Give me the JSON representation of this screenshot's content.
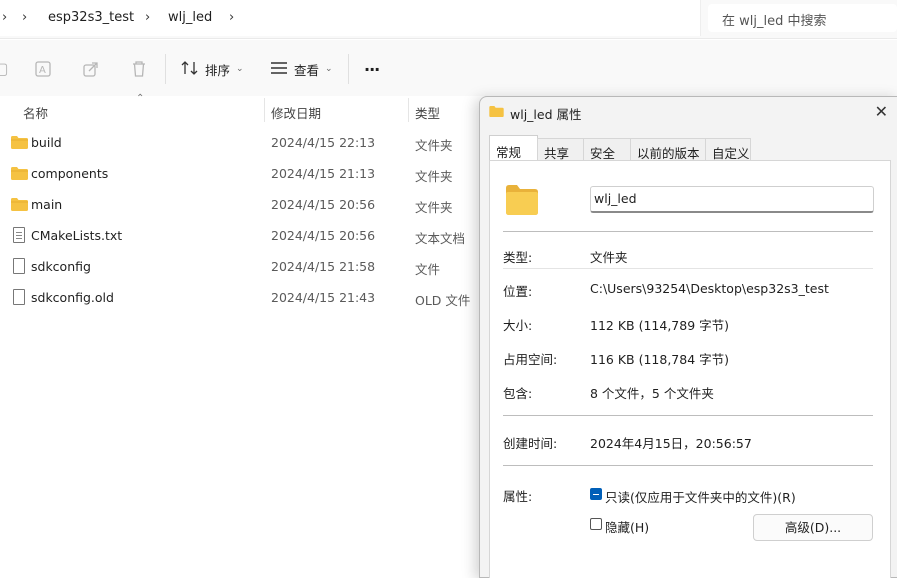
{
  "address": {
    "crumbs": [
      "esp32s3_test",
      "wlj_led"
    ],
    "search_placeholder": "在 wlj_led 中搜索"
  },
  "toolbar": {
    "sort_label": "排序",
    "view_label": "查看",
    "more_label": "···"
  },
  "columns": {
    "name": "名称",
    "date": "修改日期",
    "type": "类型"
  },
  "files": [
    {
      "name": "build",
      "date": "2024/4/15 22:13",
      "type": "文件夹",
      "icon": "folder-icon"
    },
    {
      "name": "components",
      "date": "2024/4/15 21:13",
      "type": "文件夹",
      "icon": "folder-icon"
    },
    {
      "name": "main",
      "date": "2024/4/15 20:56",
      "type": "文件夹",
      "icon": "folder-icon"
    },
    {
      "name": "CMakeLists.txt",
      "date": "2024/4/15 20:56",
      "type": "文本文档",
      "icon": "text-file-icon"
    },
    {
      "name": "sdkconfig",
      "date": "2024/4/15 21:58",
      "type": "文件",
      "icon": "file-icon"
    },
    {
      "name": "sdkconfig.old",
      "date": "2024/4/15 21:43",
      "type": "OLD 文件",
      "icon": "file-icon"
    }
  ],
  "dialog": {
    "title": "wlj_led 属性",
    "close": "✕",
    "tabs": [
      "常规",
      "共享",
      "安全",
      "以前的版本",
      "自定义"
    ],
    "name_value": "wlj_led",
    "type_label": "类型:",
    "type_value": "文件夹",
    "location_label": "位置:",
    "location_value": "C:\\Users\\93254\\Desktop\\esp32s3_test",
    "size_label": "大小:",
    "size_value": "112 KB (114,789 字节)",
    "disk_label": "占用空间:",
    "disk_value": "116 KB (118,784 字节)",
    "contains_label": "包含:",
    "contains_value": "8 个文件，5 个文件夹",
    "created_label": "创建时间:",
    "created_value": "2024年4月15日，20:56:57",
    "attr_label": "属性:",
    "readonly_label": "只读(仅应用于文件夹中的文件)(R)",
    "hidden_label": "隐藏(H)",
    "advanced_label": "高级(D)...",
    "readonly_state": "indeterminate",
    "hidden_state": "unchecked"
  },
  "colors": {
    "folder": "#f5c242",
    "accent": "#005fb8"
  }
}
